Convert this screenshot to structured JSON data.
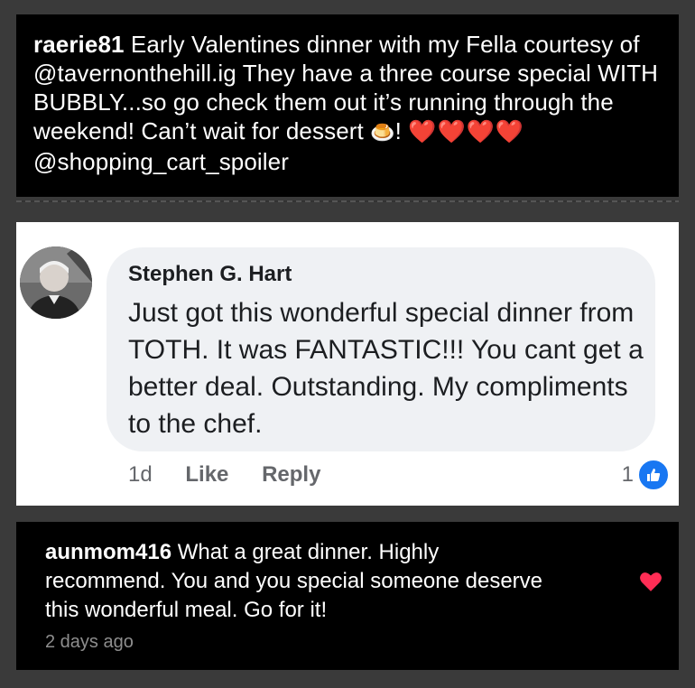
{
  "post": {
    "username": "raerie81",
    "caption": "Early Valentines dinner with my Fella courtesy of @tavernonthehill.ig  They have a three course special WITH BUBBLY...so go check them out it’s running through the weekend! Can’t wait for dessert",
    "emoji_custard": "🍮",
    "excl": "!",
    "hearts": "❤️❤️❤️❤️",
    "mention": "@shopping_cart_spoiler"
  },
  "fb_comment": {
    "author": "Stephen G. Hart",
    "text": "Just got this wonderful special dinner from TOTH. It was FANTASTIC!!! You cant get a better deal. Outstanding. My compliments to the chef.",
    "time": "1d",
    "like_label": "Like",
    "reply_label": "Reply",
    "reaction_count": "1"
  },
  "ig_comment": {
    "username": "aunmom416",
    "text": "What a great dinner. Highly recommend. You and you special someone deserve this wonderful meal. Go for it!",
    "time_ago": "2 days ago"
  },
  "colors": {
    "background": "#3a3a3a",
    "fb_blue": "#1877f2",
    "heart_red": "#ff2d3f",
    "muted_gray": "#8e8e8e"
  },
  "icons": [
    "custard-emoji-icon",
    "heart-icon",
    "like-thumb-icon",
    "avatar"
  ]
}
